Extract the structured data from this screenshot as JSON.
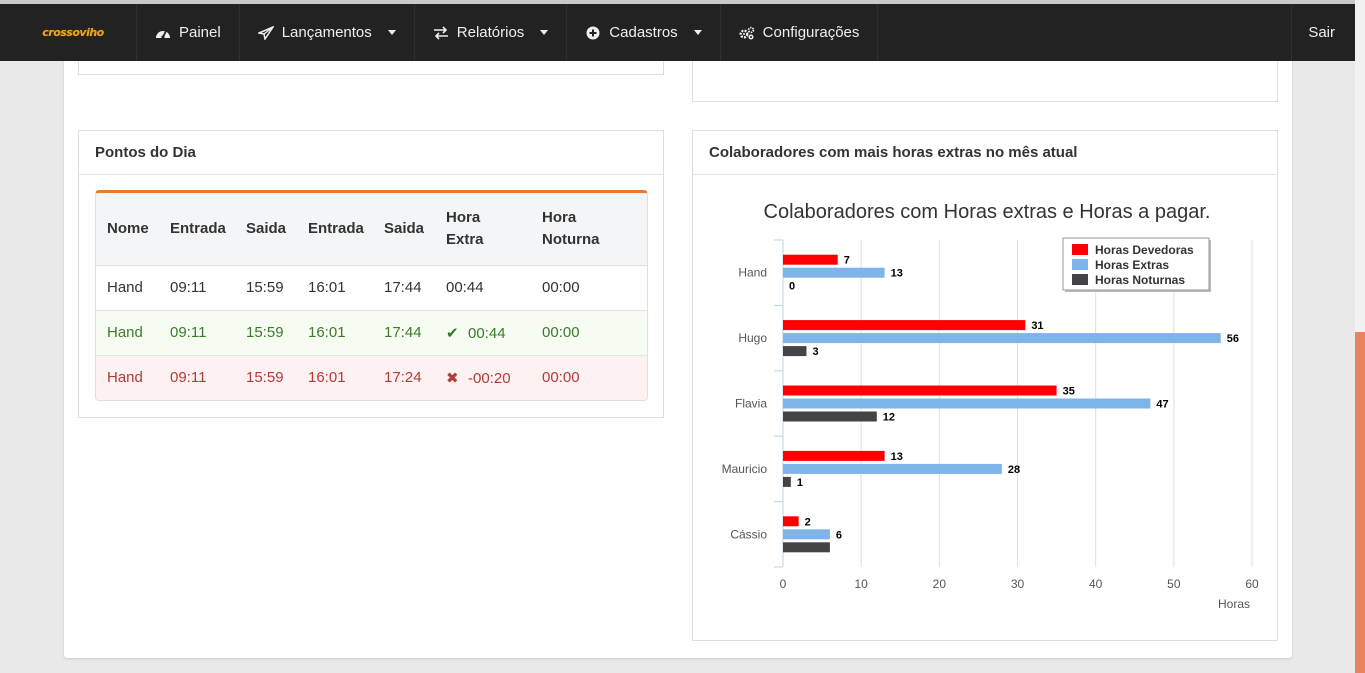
{
  "nav": {
    "brand": "crossoviho",
    "items": [
      {
        "label": "Painel",
        "icon": "dashboard-icon",
        "dropdown": false
      },
      {
        "label": "Lançamentos",
        "icon": "paper-plane-icon",
        "dropdown": true
      },
      {
        "label": "Relatórios",
        "icon": "exchange-icon",
        "dropdown": true
      },
      {
        "label": "Cadastros",
        "icon": "plus-circle-icon",
        "dropdown": true
      },
      {
        "label": "Configurações",
        "icon": "gears-icon",
        "dropdown": false
      }
    ],
    "logout": "Sair"
  },
  "pontos": {
    "title": "Pontos do Dia",
    "headers": [
      "Nome",
      "Entrada",
      "Saida",
      "Entrada",
      "Saida",
      "Hora Extra",
      "Hora Noturna"
    ],
    "rows": [
      {
        "status": "neutral",
        "cells": [
          "Hand",
          "09:11",
          "15:59",
          "16:01",
          "17:44",
          "00:44",
          "00:00"
        ]
      },
      {
        "status": "ok",
        "cells": [
          "Hand",
          "09:11",
          "15:59",
          "16:01",
          "17:44",
          "00:44",
          "00:00"
        ]
      },
      {
        "status": "bad",
        "cells": [
          "Hand",
          "09:11",
          "15:59",
          "16:01",
          "17:24",
          "-00:20",
          "00:00"
        ]
      }
    ]
  },
  "colaboradores": {
    "title": "Colaboradores com mais horas extras no mês atual"
  },
  "chart_data": {
    "type": "bar",
    "orientation": "horizontal",
    "title": "Colaboradores com Horas extras e Horas a pagar.",
    "xlabel": "Horas",
    "ylabel": "",
    "xlim": [
      0,
      60
    ],
    "xticks": [
      0,
      10,
      20,
      30,
      40,
      50,
      60
    ],
    "grid": true,
    "legend_position": "top-right",
    "categories": [
      "Hand",
      "Hugo",
      "Flavia",
      "Mauricio",
      "Cássio"
    ],
    "series": [
      {
        "name": "Horas Devedoras",
        "color": "#ff0000",
        "values": [
          7,
          31,
          35,
          13,
          2
        ]
      },
      {
        "name": "Horas Extras",
        "color": "#7eb4ea",
        "values": [
          13,
          56,
          47,
          28,
          6
        ]
      },
      {
        "name": "Horas Noturnas",
        "color": "#434348",
        "values": [
          0,
          3,
          12,
          1,
          6
        ]
      }
    ],
    "data_labels": [
      [
        "7",
        "13",
        "0"
      ],
      [
        "31",
        "56",
        "3"
      ],
      [
        "35",
        "47",
        "12"
      ],
      [
        "13",
        "28",
        "1"
      ],
      [
        "2",
        "6",
        ""
      ]
    ]
  }
}
